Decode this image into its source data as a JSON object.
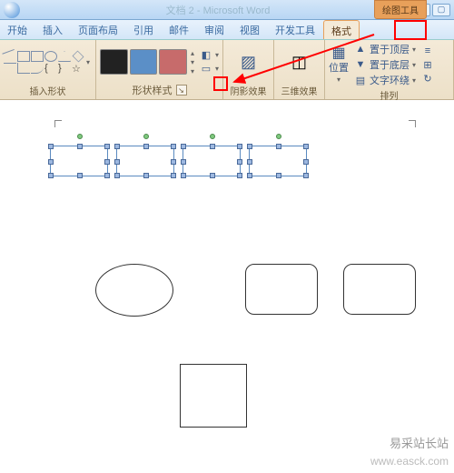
{
  "title": {
    "app": "Microsoft Word",
    "doc": "文档 2",
    "ctx_tab": "绘图工具"
  },
  "win": {
    "min": "▁",
    "max": "▢",
    "close": "✕"
  },
  "tabs": [
    "开始",
    "插入",
    "页面布局",
    "引用",
    "邮件",
    "审阅",
    "视图",
    "开发工具",
    "格式"
  ],
  "active_tab": 8,
  "groups": {
    "insert_shapes": "插入形状",
    "shape_styles": "形状样式",
    "shadow": "阴影效果",
    "threeD": "三维效果",
    "arrange": "排列"
  },
  "arrange": {
    "position": "位置",
    "front": "置于顶层",
    "back": "置于底层",
    "wrap": "文字环绕"
  },
  "watermark": "易采站长站",
  "watermark_url": "www.easck.com"
}
